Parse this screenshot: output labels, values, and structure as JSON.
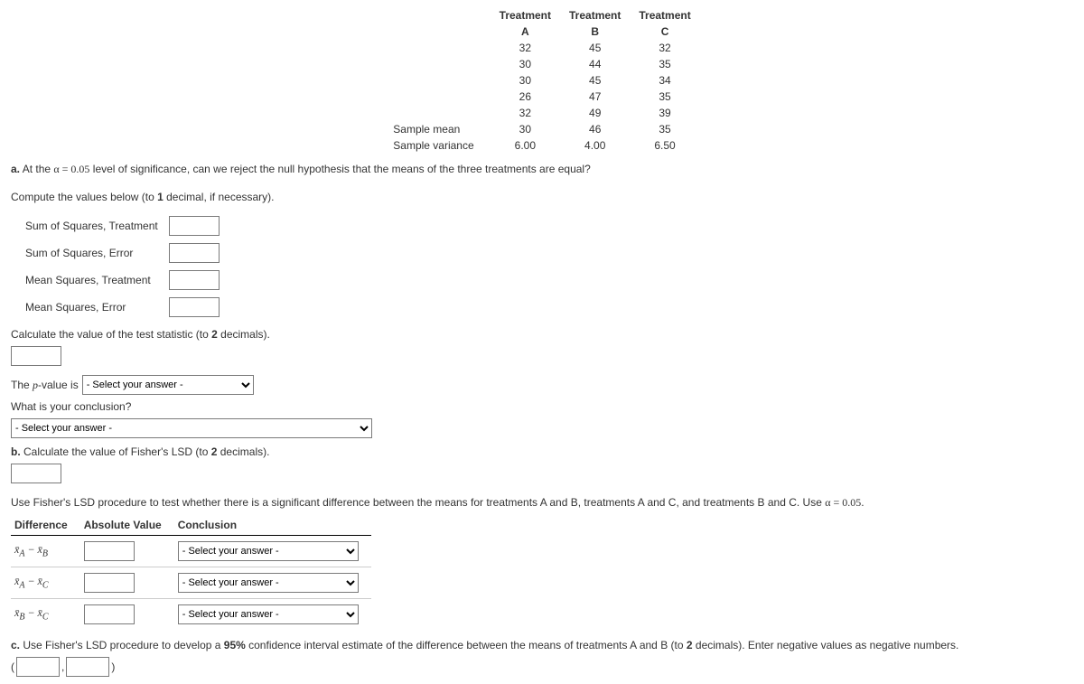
{
  "table": {
    "header": [
      "Treatment",
      "Treatment",
      "Treatment"
    ],
    "sub": [
      "A",
      "B",
      "C"
    ],
    "rows": [
      [
        "32",
        "45",
        "32"
      ],
      [
        "30",
        "44",
        "35"
      ],
      [
        "30",
        "45",
        "34"
      ],
      [
        "26",
        "47",
        "35"
      ],
      [
        "32",
        "49",
        "39"
      ]
    ],
    "meanLabel": "Sample mean",
    "meanRow": [
      "30",
      "46",
      "35"
    ],
    "varLabel": "Sample variance",
    "varRow": [
      "6.00",
      "4.00",
      "6.50"
    ]
  },
  "qa": {
    "label": "a.",
    "text1": " At the ",
    "alpha": "α = 0.05",
    "text2": " level of significance, can we reject the null hypothesis that the means of the three treatments are equal?"
  },
  "compute": {
    "prompt1": "Compute the values below (to ",
    "one": "1",
    "prompt2": " decimal, if necessary).",
    "rows": {
      "sst": "Sum of Squares, Treatment",
      "sse": "Sum of Squares, Error",
      "mst": "Mean Squares, Treatment",
      "mse": "Mean Squares, Error"
    },
    "calc1": "Calculate the value of the test statistic (to ",
    "two": "2",
    "calc2": " decimals)."
  },
  "pval": {
    "label": "The ",
    "p": "p",
    "rest": "-value is",
    "placeholder": "- Select your answer -"
  },
  "conclusion": {
    "label": "What is your conclusion?",
    "placeholder": "- Select your answer -"
  },
  "qb": {
    "label": "b.",
    "text1": " Calculate the value of Fisher's LSD (to ",
    "two": "2",
    "text2": " decimals)."
  },
  "lsdIntro": {
    "text1": "Use Fisher's LSD procedure to test whether there is a significant difference between the means for treatments A and B, treatments A and C, and treatments B and C. Use ",
    "alpha": "α = 0.05",
    "text2": "."
  },
  "lsdTable": {
    "headers": [
      "Difference",
      "Absolute Value",
      "Conclusion"
    ],
    "rows": [
      {
        "diff": "x̅_A − x̅_B"
      },
      {
        "diff": "x̅_A − x̅_C"
      },
      {
        "diff": "x̅_B − x̅_C"
      }
    ],
    "placeholder": "- Select your answer -"
  },
  "qc": {
    "label": "c.",
    "text1": " Use Fisher's LSD procedure to develop a ",
    "pct": "95%",
    "text2": " confidence interval estimate of the difference between the means of treatments A and B (to ",
    "two": "2",
    "text3": " decimals). Enter negative values as negative numbers."
  },
  "ci": {
    "open": "(",
    "comma": ",",
    "close": ")"
  }
}
